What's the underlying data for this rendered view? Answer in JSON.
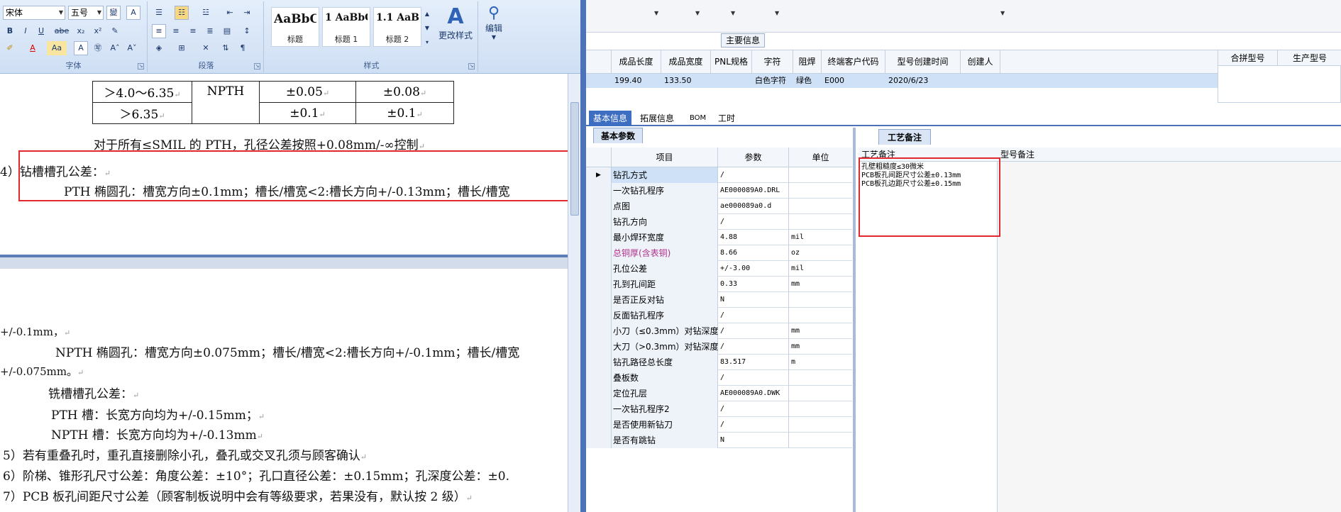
{
  "word": {
    "ribbon": {
      "font_name": "宋体",
      "font_size": "五号",
      "groups": {
        "font": "字体",
        "paragraph": "段落",
        "styles": "样式"
      },
      "style_cards": [
        {
          "sample": "AaBbC",
          "name": "标题"
        },
        {
          "sample": "1 AaBbC",
          "name": "标题 1"
        },
        {
          "sample": "1.1 AaBb",
          "name": "标题 2"
        }
      ],
      "change_styles": "更改样式",
      "edit": "编辑"
    },
    "table": {
      "row1": {
        "range": "＞4.0～6.35",
        "type": "NPTH",
        "tol1": "±0.05",
        "tol2": "±0.08"
      },
      "row2": {
        "range": "＞6.35",
        "tol1": "±0.1",
        "tol2": "±0.1"
      }
    },
    "lines_top": [
      "对于所有≤SMIL 的 PTH，孔径公差按照+0.08mm/-∞控制",
      "4）钻槽槽孔公差：",
      "PTH 椭圆孔：槽宽方向±0.1mm；槽长/槽宽<2:槽长方向+/-0.13mm；槽长/槽宽"
    ],
    "lines_bottom": [
      "+/-0.1mm，",
      "NPTH 椭圆孔：槽宽方向±0.075mm；槽长/槽宽<2:槽长方向+/-0.1mm；槽长/槽宽",
      "+/-0.075mm。",
      "铣槽槽孔公差：",
      "PTH 槽：长宽方向均为+/-0.15mm；",
      "NPTH 槽：长宽方向均为+/-0.13mm",
      "5）若有重叠孔时，重孔直接删除小孔，叠孔或交叉孔须与顾客确认",
      "6）阶梯、锥形孔尺寸公差：角度公差：±10°；孔口直径公差：±0.15mm；孔深度公差：±0.",
      "7）PCB 板孔间距尺寸公差（顾客制板说明中会有等级要求，若果没有，默认按 2 级）"
    ]
  },
  "erp": {
    "section_title": "主要信息",
    "main_headers": [
      "成品长度",
      "成品宽度",
      "PNL规格",
      "字符",
      "阻焊",
      "终端客户代码",
      "型号创建时间",
      "创建人"
    ],
    "main_row": [
      "199.40",
      "133.50",
      "",
      "白色字符",
      "绿色",
      "E000",
      "2020/6/23",
      ""
    ],
    "right_headers": [
      "合拼型号",
      "生产型号"
    ],
    "tabs": [
      "基本信息",
      "拓展信息",
      "BOM",
      "工时"
    ],
    "param_tab": "基本参数",
    "param_headers": [
      "项目",
      "参数",
      "单位"
    ],
    "params": [
      {
        "item": "钻孔方式",
        "value": "/",
        "unit": ""
      },
      {
        "item": "一次钻孔程序",
        "value": "AE000089A0.DRL",
        "unit": ""
      },
      {
        "item": "点图",
        "value": "ae000089a0.d",
        "unit": ""
      },
      {
        "item": "钻孔方向",
        "value": "/",
        "unit": ""
      },
      {
        "item": "最小焊环宽度",
        "value": "4.88",
        "unit": "mil"
      },
      {
        "item": "总铜厚(含表铜)",
        "value": "8.66",
        "unit": "oz"
      },
      {
        "item": "孔位公差",
        "value": "+/-3.00",
        "unit": "mil"
      },
      {
        "item": "孔到孔间距",
        "value": "0.33",
        "unit": "mm"
      },
      {
        "item": "是否正反对钻",
        "value": "N",
        "unit": ""
      },
      {
        "item": "反面钻孔程序",
        "value": "/",
        "unit": ""
      },
      {
        "item": "小刀（≤0.3mm）对钻深度",
        "value": "/",
        "unit": "mm"
      },
      {
        "item": "大刀（>0.3mm）对钻深度",
        "value": "/",
        "unit": "mm"
      },
      {
        "item": "钻孔路径总长度",
        "value": "83.517",
        "unit": "m"
      },
      {
        "item": "叠板数",
        "value": "/",
        "unit": ""
      },
      {
        "item": "定位孔层",
        "value": "AE000089A0.DWK",
        "unit": ""
      },
      {
        "item": "一次钻孔程序2",
        "value": "/",
        "unit": ""
      },
      {
        "item": "是否使用新钻刀",
        "value": "/",
        "unit": ""
      },
      {
        "item": "是否有跳钻",
        "value": "N",
        "unit": ""
      }
    ],
    "remark_tab": "工艺备注",
    "remark_headers": [
      "工艺备注",
      "型号备注"
    ],
    "remark_lines": [
      "孔壁粗糙度≤30微米",
      "PCB板孔间距尺寸公差±0.13mm",
      "PCB板孔边距尺寸公差±0.15mm"
    ],
    "colors": {
      "highlight_row": "#cfe1f7",
      "accent": "#3d6ec2",
      "red_box": "#e0282e",
      "magenta_label": "#b0308a"
    }
  }
}
